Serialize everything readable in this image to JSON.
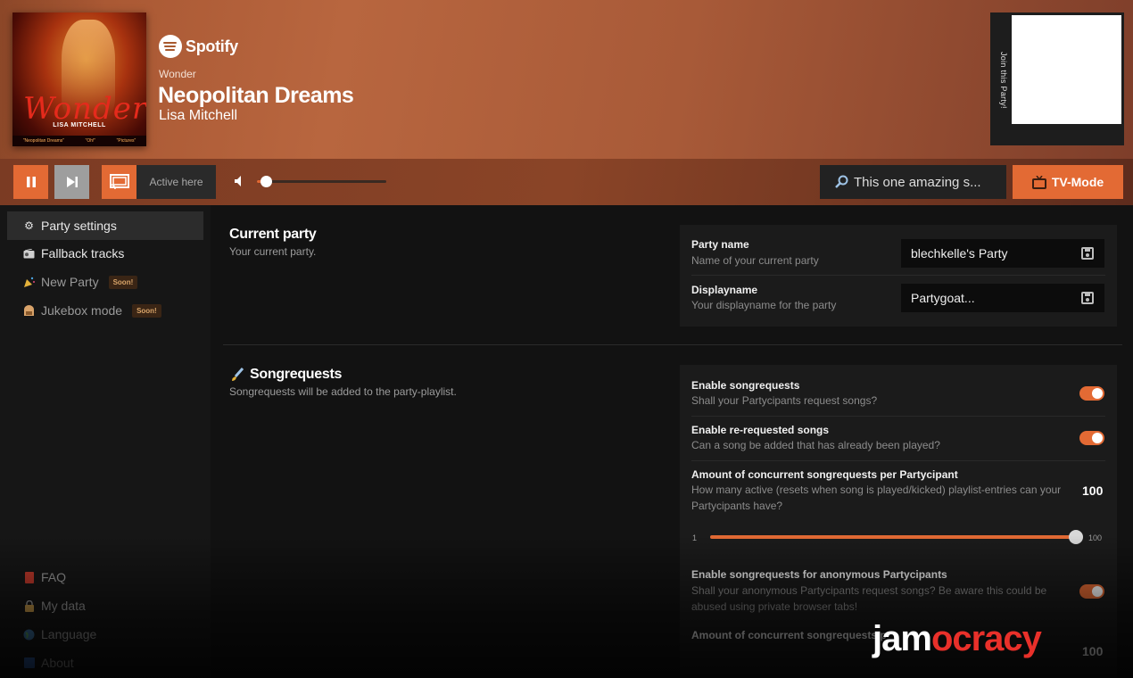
{
  "now_playing": {
    "service": "Spotify",
    "album": "Wonder",
    "track": "Neopolitan Dreams",
    "artist": "Lisa Mitchell",
    "cover_title": "Wonder",
    "cover_artist": "LISA MITCHELL",
    "cover_strip": [
      "\"Neopolitan Dreams\"",
      "\"Oh!\"",
      "\"Pictures\""
    ],
    "join_label": "Join this Party!"
  },
  "controls": {
    "active_label": "Active here",
    "volume": 0.07,
    "search_text": "This one amazing s...",
    "tv_mode_label": "TV-Mode"
  },
  "sidebar": {
    "items": [
      {
        "label": "Party settings",
        "icon": "gear-icon"
      },
      {
        "label": "Fallback tracks",
        "icon": "radio-icon"
      },
      {
        "label": "New Party",
        "icon": "party-popper-icon",
        "badge": "Soon!"
      },
      {
        "label": "Jukebox mode",
        "icon": "jukebox-icon",
        "badge": "Soon!"
      }
    ],
    "bottom": [
      {
        "label": "FAQ",
        "icon": "book-icon"
      },
      {
        "label": "My data",
        "icon": "lock-icon"
      },
      {
        "label": "Language",
        "icon": "globe-icon"
      },
      {
        "label": "About",
        "icon": "info-icon"
      }
    ]
  },
  "current_party": {
    "title": "Current party",
    "subtitle": "Your current party.",
    "party_name": {
      "title": "Party name",
      "desc": "Name of your current party",
      "value": "blechkelle's Party"
    },
    "displayname": {
      "title": "Displayname",
      "desc": "Your displayname for the party",
      "value": "Partygoat..."
    }
  },
  "songrequests": {
    "title": "Songrequests",
    "subtitle": "Songrequests will be added to the party-playlist.",
    "enable": {
      "title": "Enable songrequests",
      "desc": "Shall your Partycipants request songs?",
      "on": true
    },
    "rerequest": {
      "title": "Enable re-requested songs",
      "desc": "Can a song be added that has already been played?",
      "on": true
    },
    "concurrent": {
      "title": "Amount of concurrent songrequests per Partycipant",
      "desc": "How many active (resets when song is played/kicked) playlist-entries can your Partycipants have?",
      "value": "100",
      "min": "1",
      "max": "100"
    },
    "anonymous": {
      "title": "Enable songrequests for anonymous Partycipants",
      "desc": "Shall your anonymous Partycipants request songs? Be aware this could be abused using private browser tabs!",
      "on": true
    },
    "anon_concurrent": {
      "title": "Amount of concurrent songrequests p",
      "value": "100"
    }
  },
  "brand": {
    "white": "jam",
    "red": "ocracy"
  },
  "colors": {
    "accent": "#e36a34",
    "brand_red": "#e8302a"
  }
}
